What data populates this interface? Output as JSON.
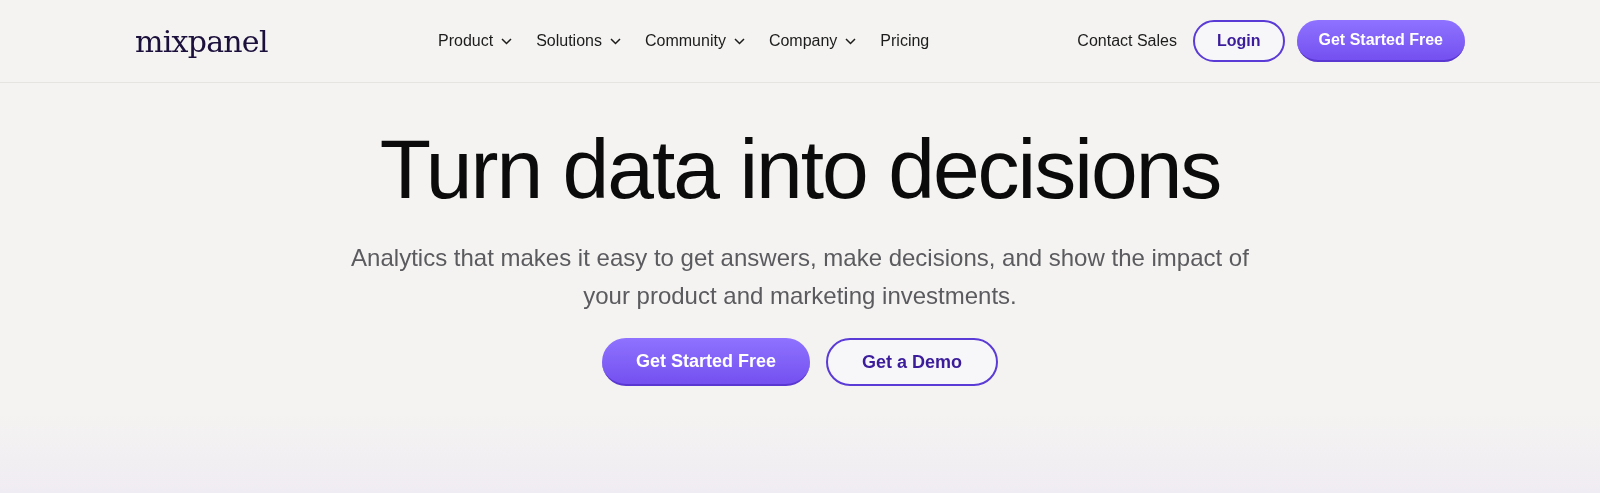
{
  "header": {
    "logo": "mixpanel",
    "nav": [
      {
        "label": "Product",
        "dropdown": true
      },
      {
        "label": "Solutions",
        "dropdown": true
      },
      {
        "label": "Community",
        "dropdown": true
      },
      {
        "label": "Company",
        "dropdown": true
      },
      {
        "label": "Pricing",
        "dropdown": false
      }
    ],
    "actions": [
      {
        "label": "Contact Sales",
        "kind": "link"
      },
      {
        "label": "Login",
        "kind": "outline"
      },
      {
        "label": "Get Started Free",
        "kind": "primary"
      }
    ]
  },
  "hero": {
    "title": "Turn data into decisions",
    "subtitle": "Analytics that makes it easy to get answers, make decisions, and show the impact of your product and marketing investments.",
    "buttons": [
      {
        "label": "Get Started Free",
        "kind": "primary"
      },
      {
        "label": "Get a Demo",
        "kind": "outline"
      }
    ]
  }
}
